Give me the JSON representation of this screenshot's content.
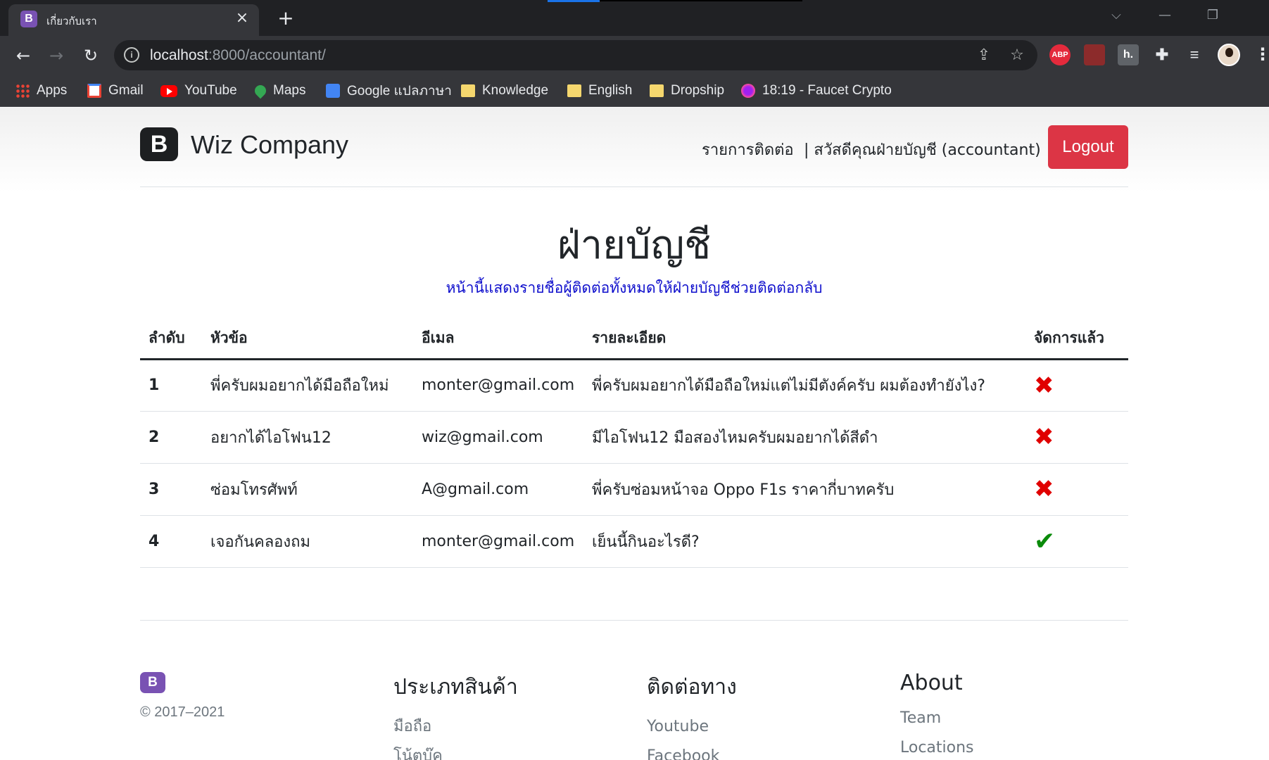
{
  "browser": {
    "tab_title": "เกี่ยวกับเรา",
    "tab_favicon": "B",
    "new_tab": "+",
    "url_host": "localhost",
    "url_rest": ":8000/accountant/",
    "bookmarks": [
      {
        "label": "Apps",
        "icon": "apps-icon"
      },
      {
        "label": "Gmail",
        "icon": "gmail-icon"
      },
      {
        "label": "YouTube",
        "icon": "youtube-icon"
      },
      {
        "label": "Maps",
        "icon": "maps-icon"
      },
      {
        "label": "Google แปลภาษา",
        "icon": "translate-icon"
      },
      {
        "label": "Knowledge",
        "icon": "folder-icon"
      },
      {
        "label": "English",
        "icon": "folder-icon"
      },
      {
        "label": "Dropship",
        "icon": "folder-icon"
      },
      {
        "label": "18:19 - Faucet Crypto",
        "icon": "faucet-icon"
      }
    ],
    "extensions": {
      "abp": "ABP",
      "h": "h."
    }
  },
  "header": {
    "brand_logo": "B",
    "brand_name": "Wiz Company",
    "nav_contacts": "รายการติดต่อ",
    "greeting": "| สวัสดีคุณฝ่ายบัญชี (accountant)",
    "logout": "Logout"
  },
  "main": {
    "title": "ฝ่ายบัญชี",
    "subtitle": "หน้านี้แสดงรายชื่อผู้ติดต่อทั้งหมดให้ฝ่ายบัญชีช่วยติดต่อกลับ",
    "columns": [
      "ลำดับ",
      "หัวข้อ",
      "อีเมล",
      "รายละเอียด",
      "จัดการแล้ว"
    ],
    "rows": [
      {
        "no": "1",
        "topic": "พี่ครับผมอยากได้มือถือใหม่",
        "email": "monter@gmail.com",
        "detail": "พี่ครับผมอยากได้มือถือใหม่แต่ไม่มีตังค์ครับ ผมต้องทำยังไง?",
        "handled": false
      },
      {
        "no": "2",
        "topic": "อยากได้ไอโฟน12",
        "email": "wiz@gmail.com",
        "detail": "มีไอโฟน12 มือสองไหมครับผมอยากได้สีดำ",
        "handled": false
      },
      {
        "no": "3",
        "topic": "ซ่อมโทรศัพท์",
        "email": "A@gmail.com",
        "detail": "พี่ครับซ่อมหน้าจอ Oppo F1s ราคากี่บาทครับ",
        "handled": false
      },
      {
        "no": "4",
        "topic": "เจอกันคลองถม",
        "email": "monter@gmail.com",
        "detail": "เย็นนี้กินอะไรดี?",
        "handled": true
      }
    ],
    "marks": {
      "no": "✖",
      "yes": "✔"
    }
  },
  "footer": {
    "logo": "B",
    "copyright": "© 2017–2021",
    "cols": [
      {
        "title": "ประเภทสินค้า",
        "links": [
          "มือถือ",
          "โน้ตบุ๊ค"
        ]
      },
      {
        "title": "ติดต่อทาง",
        "links": [
          "Youtube",
          "Facebook"
        ]
      },
      {
        "title": "About",
        "links": [
          "Team",
          "Locations"
        ]
      }
    ]
  },
  "colors": {
    "logout": "#dc3545",
    "subtitle": "#0d0dcc",
    "x_mark": "#e00000",
    "check_mark": "#0a8a0a",
    "brand_purple": "#7952b3"
  }
}
